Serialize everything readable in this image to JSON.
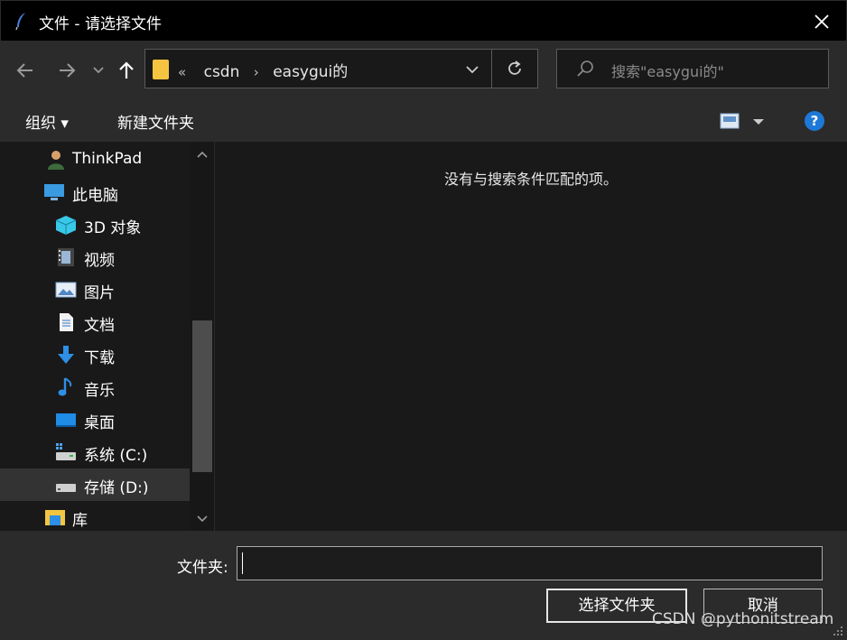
{
  "window": {
    "title": "文件 - 请选择文件"
  },
  "nav": {
    "breadcrumb": {
      "prefix": "«",
      "items": [
        "csdn",
        "easygui的"
      ]
    },
    "search_placeholder": "搜索\"easygui的\""
  },
  "toolbar": {
    "organize_label": "组织 ▾",
    "new_folder_label": "新建文件夹"
  },
  "sidebar": {
    "items": [
      {
        "label": "ThinkPad",
        "icon": "user-icon"
      },
      {
        "label": "此电脑",
        "icon": "computer-icon"
      },
      {
        "label": "3D 对象",
        "icon": "cube-3d-icon"
      },
      {
        "label": "视频",
        "icon": "video-icon"
      },
      {
        "label": "图片",
        "icon": "picture-icon"
      },
      {
        "label": "文档",
        "icon": "document-icon"
      },
      {
        "label": "下载",
        "icon": "download-icon"
      },
      {
        "label": "音乐",
        "icon": "music-icon"
      },
      {
        "label": "桌面",
        "icon": "desktop-icon"
      },
      {
        "label": "系统 (C:)",
        "icon": "system-drive-icon"
      },
      {
        "label": "存储 (D:)",
        "icon": "drive-icon",
        "selected": true
      },
      {
        "label": "库",
        "icon": "library-icon"
      }
    ]
  },
  "content": {
    "empty_message": "没有与搜索条件匹配的项。"
  },
  "bottom": {
    "folder_label": "文件夹:",
    "folder_value": "",
    "ok_label": "选择文件夹",
    "cancel_label": "取消",
    "watermark": "CSDN @pythonitstream"
  },
  "colors": {
    "title_bar": "#000000",
    "panel": "#2b2b2b",
    "background": "#191919",
    "help_blue": "#1e78d7"
  }
}
